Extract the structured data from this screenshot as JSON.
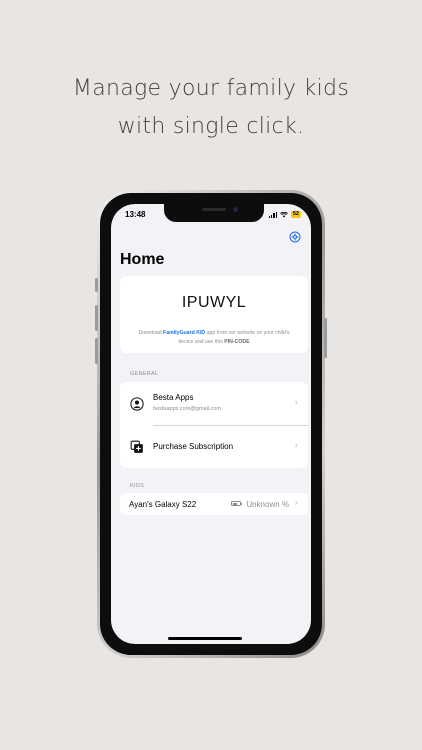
{
  "headline": {
    "line1": "Manage your family kids",
    "line2": "with single click."
  },
  "status_bar": {
    "time": "13:48",
    "battery": "52"
  },
  "home": {
    "title": "Home",
    "pin_code": "IPUWYL",
    "pin_hint_prefix": "Download ",
    "pin_hint_app": "FamilyGuard KID",
    "pin_hint_middle": " app from our website on your child's device and use this ",
    "pin_hint_code_label": "PIN-CODE"
  },
  "general": {
    "section_label": "GENERAL",
    "account_name": "Besta Apps",
    "account_email": "bestaapps.com@gmail.com",
    "subscription_label": "Purchase Subscription"
  },
  "kids": {
    "section_label": "KIDS",
    "items": [
      {
        "device_name": "Ayan's Galaxy S22",
        "battery_status": "Unknown %"
      }
    ]
  },
  "colors": {
    "accent": "#1a73e8",
    "background": "#e8e5e3",
    "screen_background": "#f2f2f7",
    "battery_badge": "#f5c518"
  },
  "icons": {
    "settings": "settings-icon",
    "account": "account-circle-icon",
    "subscription": "add-subscription-icon",
    "chevron": "chevron-right-icon",
    "battery": "battery-icon"
  }
}
